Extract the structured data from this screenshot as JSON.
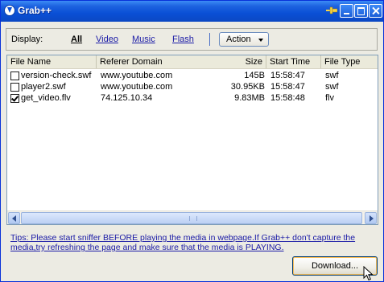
{
  "window": {
    "title": "Grab++",
    "icons": {
      "app": "app-logo-icon",
      "pin": "pin-icon",
      "minimize": "minimize-icon",
      "maximize": "maximize-icon",
      "close": "close-icon"
    }
  },
  "toolbar": {
    "display_label": "Display:",
    "filters": [
      "All",
      "Video",
      "Music",
      "Flash"
    ],
    "active_filter": "All",
    "action_label": "Action"
  },
  "table": {
    "columns": [
      "File Name",
      "Referer Domain",
      "Size",
      "Start Time",
      "File Type"
    ],
    "rows": [
      {
        "checked": false,
        "name": "version-check.swf",
        "referer": "www.youtube.com",
        "size": "145B",
        "start": "15:58:47",
        "type": "swf"
      },
      {
        "checked": false,
        "name": "player2.swf",
        "referer": "www.youtube.com",
        "size": "30.95KB",
        "start": "15:58:47",
        "type": "swf"
      },
      {
        "checked": true,
        "name": "get_video.flv",
        "referer": "74.125.10.34",
        "size": "9.83MB",
        "start": "15:58:48",
        "type": "flv"
      }
    ]
  },
  "tips": "Tips: Please start sniffer BEFORE playing the media in webpage.If Grab++ don't capture the media,try refreshing the page and make sure that the media is PLAYING.",
  "download_label": "Download...",
  "colors": {
    "titlebar": "#0a4fd6",
    "link": "#1a1aa6",
    "face": "#ecebe3"
  }
}
